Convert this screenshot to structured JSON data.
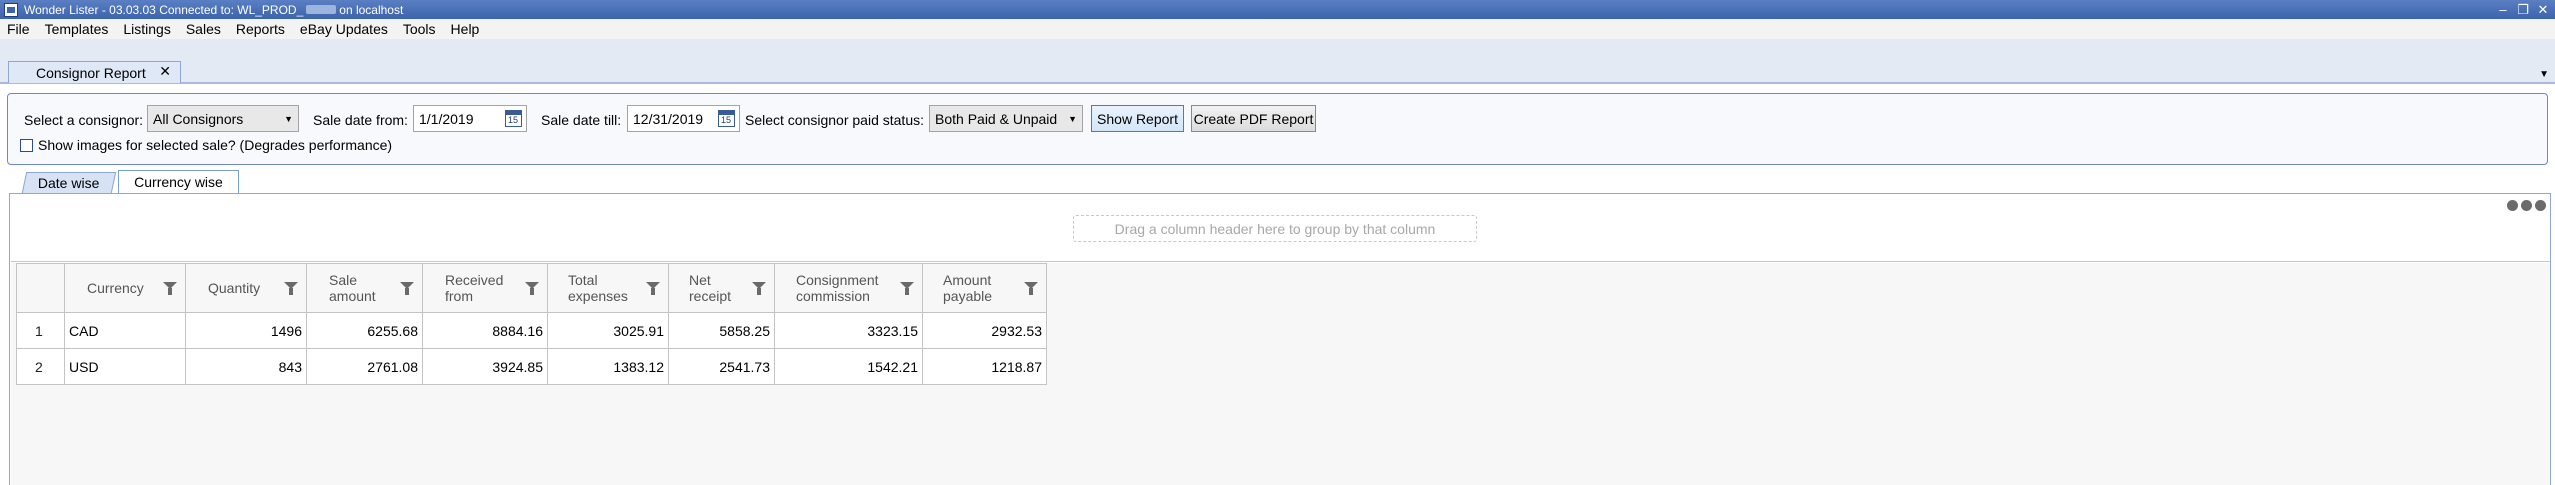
{
  "window": {
    "title": "Wonder Lister - 03.03.03 Connected to: WL_PROD_",
    "title_suffix": "on localhost",
    "minimize": "–",
    "restore": "❐",
    "close": "✕"
  },
  "menu": [
    "File",
    "Templates",
    "Listings",
    "Sales",
    "Reports",
    "eBay Updates",
    "Tools",
    "Help"
  ],
  "doc_tab": {
    "label": "Consignor Report",
    "close": "✕",
    "dropdown": "▼"
  },
  "filters": {
    "consignor_label": "Select a consignor:",
    "consignor_value": "All Consignors",
    "date_from_label": "Sale date from:",
    "date_from_value": "1/1/2019",
    "date_till_label": "Sale date till:",
    "date_till_value": "12/31/2019",
    "paid_status_label": "Select consignor paid status:",
    "paid_status_value": "Both Paid & Unpaid",
    "show_report": "Show Report",
    "create_pdf": "Create PDF Report",
    "show_images_label": "Show images for selected sale? (Degrades performance)",
    "calendar_glyph": "15"
  },
  "view_tabs": [
    "Date wise",
    "Currency wise"
  ],
  "grid": {
    "group_hint": "Drag a column header here to group by that column",
    "columns": [
      {
        "line1": "Currency",
        "line2": ""
      },
      {
        "line1": "Quantity",
        "line2": ""
      },
      {
        "line1": "Sale",
        "line2": "amount"
      },
      {
        "line1": "Received",
        "line2": "from"
      },
      {
        "line1": "Total",
        "line2": "expenses"
      },
      {
        "line1": "Net",
        "line2": "receipt"
      },
      {
        "line1": "Consignment",
        "line2": "commission"
      },
      {
        "line1": "Amount",
        "line2": "payable"
      }
    ],
    "rows": [
      {
        "n": "1",
        "currency": "CAD",
        "quantity": "1496",
        "sale_amount": "6255.68",
        "received_from": "8884.16",
        "total_expenses": "3025.91",
        "net_receipt": "5858.25",
        "consignment_commission": "3323.15",
        "amount_payable": "2932.53"
      },
      {
        "n": "2",
        "currency": "USD",
        "quantity": "843",
        "sale_amount": "2761.08",
        "received_from": "3924.85",
        "total_expenses": "1383.12",
        "net_receipt": "2541.73",
        "consignment_commission": "1542.21",
        "amount_payable": "1218.87"
      }
    ]
  }
}
